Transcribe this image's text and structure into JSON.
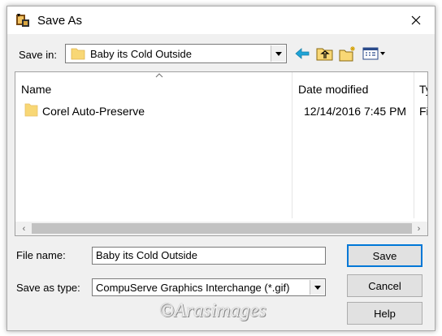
{
  "window": {
    "title": "Save As",
    "close_icon": "close-icon",
    "app_icon": "paint-app-icon"
  },
  "save_in": {
    "label": "Save in:",
    "folder": "Baby its Cold Outside",
    "folder_icon": "folder-icon"
  },
  "toolbar": {
    "icons": [
      "back-arrow-icon",
      "up-one-level-icon",
      "new-folder-icon",
      "view-menu-icon"
    ]
  },
  "file_list": {
    "columns": [
      "Name",
      "Date modified",
      "Ty"
    ],
    "rows": [
      {
        "name": "Corel Auto-Preserve",
        "date": "12/14/2016 7:45 PM",
        "type": "Fi"
      }
    ]
  },
  "file_name": {
    "label": "File name:",
    "value": "Baby its Cold Outside"
  },
  "save_type": {
    "label": "Save as type:",
    "value": "CompuServe Graphics Interchange (*.gif)"
  },
  "buttons": {
    "save": "Save",
    "cancel": "Cancel",
    "help": "Help"
  },
  "watermark": "©Arasimages",
  "colors": {
    "accent": "#0078d7",
    "folder": "#f8d775",
    "toolbar_arrow": "#1fa3d6"
  }
}
